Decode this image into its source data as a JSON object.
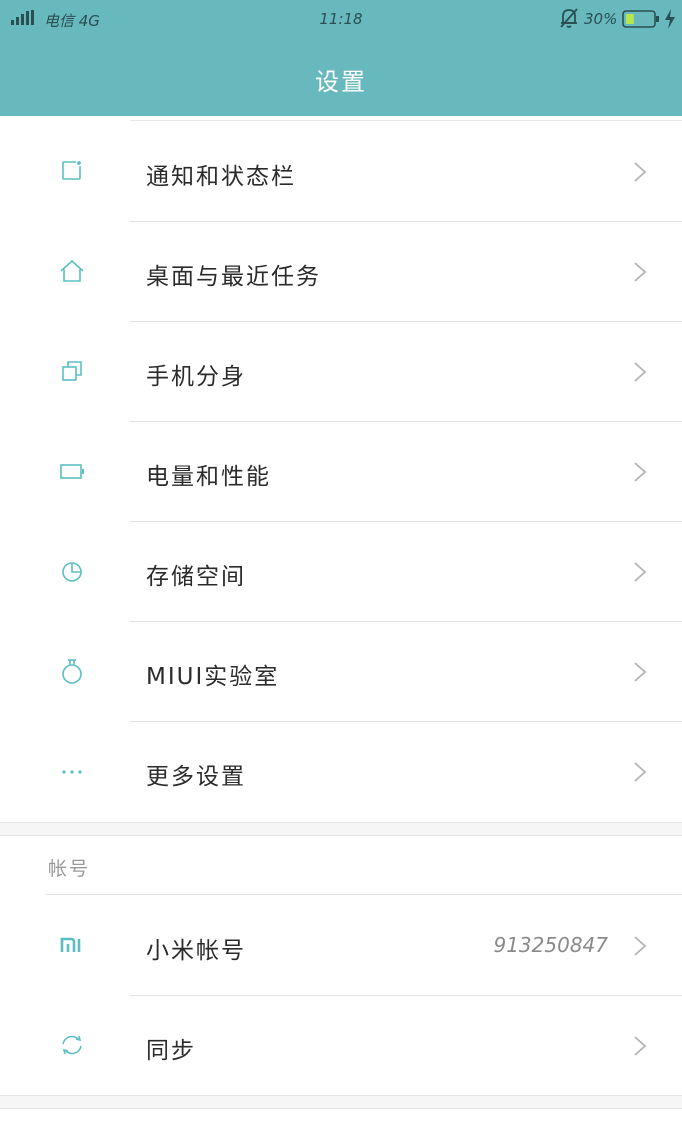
{
  "status_bar": {
    "carrier": "电信 4G",
    "time": "11:18",
    "battery_percent": "30%",
    "battery_level": 0.3
  },
  "header": {
    "title": "设置"
  },
  "colors": {
    "accent": "#67b9bd",
    "icon": "#5bbfc2"
  },
  "items": [
    {
      "label": "通知和状态栏",
      "icon": "notification-icon"
    },
    {
      "label": "桌面与最近任务",
      "icon": "home-icon"
    },
    {
      "label": "手机分身",
      "icon": "clone-icon"
    },
    {
      "label": "电量和性能",
      "icon": "battery-icon"
    },
    {
      "label": "存储空间",
      "icon": "pie-chart-icon"
    },
    {
      "label": "MIUI实验室",
      "icon": "flask-icon"
    },
    {
      "label": "更多设置",
      "icon": "more-icon"
    }
  ],
  "account_section": {
    "header": "帐号",
    "items": [
      {
        "label": "小米帐号",
        "value": "913250847",
        "icon": "mi-logo-icon"
      },
      {
        "label": "同步",
        "icon": "sync-icon"
      }
    ]
  }
}
